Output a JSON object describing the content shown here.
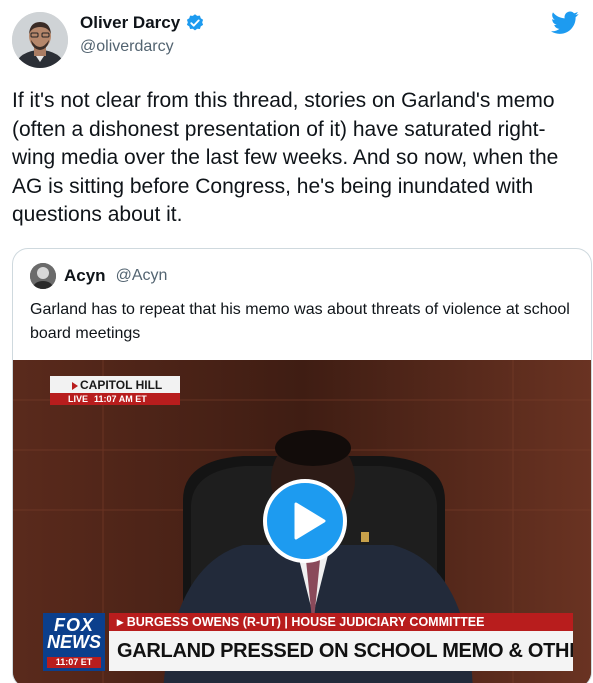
{
  "author": {
    "name": "Oliver Darcy",
    "handle": "@oliverdarcy",
    "verified": true,
    "avatar_icon": "user-avatar"
  },
  "tweet": {
    "text": "If it's not clear from this thread, stories on Garland's memo (often a dishonest presentation of it) have saturated right-wing media over the last few weeks. And so now, when the AG is sitting before Congress, he's being inundated with questions about it."
  },
  "quote": {
    "name": "Acyn",
    "handle": "@Acyn",
    "text": "Garland has to repeat that his memo was about threats of violence at school  board meetings"
  },
  "video": {
    "bug_location": "CAPITOL HILL",
    "bug_live": "LIVE",
    "bug_time": "11:07 AM ET",
    "logo_top": "FOX",
    "logo_bottom": "NEWS",
    "logo_time": "11:07 ET",
    "name_strip": "▸ BURGESS OWENS (R-UT) | HOUSE JUDICIARY COMMITTEE",
    "headline": "GARLAND PRESSED ON SCHOOL MEMO & OTHER ISSUES"
  },
  "colors": {
    "twitter_blue": "#1d9bf0",
    "fox_red": "#b81d1d",
    "fox_blue": "#0b3f8c"
  },
  "icons": {
    "twitter": "twitter-bird-icon",
    "verified": "verified-badge-icon",
    "play": "play-icon"
  }
}
